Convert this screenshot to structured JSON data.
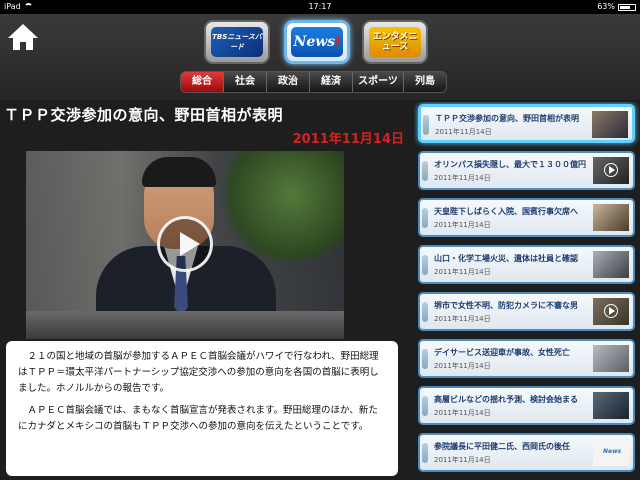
{
  "status": {
    "device": "iPad",
    "time": "17:17",
    "battery": "63%"
  },
  "header": {
    "logos": [
      {
        "label": "TBSニュースバード"
      },
      {
        "label": "News",
        "accent": "i"
      },
      {
        "label": "エンタメニュース"
      }
    ],
    "tabs": [
      "総合",
      "社会",
      "政治",
      "経済",
      "スポーツ",
      "列島"
    ],
    "active_tab": "総合"
  },
  "article": {
    "headline": "ＴＰＰ交渉参加の意向、野田首相が表明",
    "date": "2011年11月14日",
    "paragraphs": [
      "２１の国と地域の首脳が参加するＡＰＥＣ首脳会議がハワイで行なわれ、野田総理はＴＰＰ＝環太平洋パートナーシップ協定交渉への参加の意向を各国の首脳に表明しました。ホノルルからの報告です。",
      "ＡＰＥＣ首脳会議では、まもなく首脳宣言が発表されます。野田総理のほか、新たにカナダとメキシコの首脳もＴＰＰ交渉への参加の意向を伝えたということです。"
    ]
  },
  "news_list": [
    {
      "title": "ＴＰＰ交渉参加の意向、野田首相が表明",
      "date": "2011年11月14日",
      "active": true
    },
    {
      "title": "オリンパス損失隠し、最大で１３００億円",
      "date": "2011年11月14日"
    },
    {
      "title": "天皇陛下しばらく入院、国賓行事欠席へ",
      "date": "2011年11月14日"
    },
    {
      "title": "山口・化学工場火災、遺体は社員と確認",
      "date": "2011年11月14日"
    },
    {
      "title": "堺市で女性不明、防犯カメラに不審な男",
      "date": "2011年11月14日"
    },
    {
      "title": "デイサービス送迎車が事故、女性死亡",
      "date": "2011年11月14日"
    },
    {
      "title": "高層ビルなどの揺れ予測、検討会始まる",
      "date": "2011年11月14日"
    },
    {
      "title": "参院議長に平田健二氏、西岡氏の後任",
      "date": "2011年11月14日",
      "thumb_tag": "News"
    }
  ]
}
